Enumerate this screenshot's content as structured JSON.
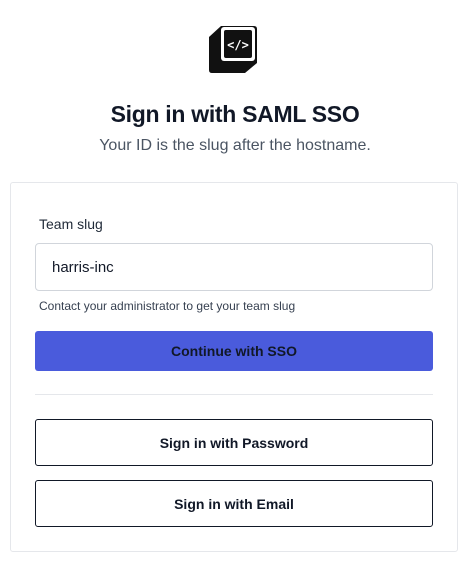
{
  "header": {
    "logo_icon": "code-cube-logo-icon",
    "title": "Sign in with SAML SSO",
    "subtitle": "Your ID is the slug after the hostname."
  },
  "form": {
    "team_slug_label": "Team slug",
    "team_slug_value": "harris-inc",
    "help_text": "Contact your administrator to get your team slug",
    "continue_label": "Continue with SSO"
  },
  "alternatives": {
    "password_label": "Sign in with Password",
    "email_label": "Sign in with Email"
  },
  "colors": {
    "primary": "#4a5bdc",
    "text": "#111827",
    "border": "#d1d5db"
  }
}
